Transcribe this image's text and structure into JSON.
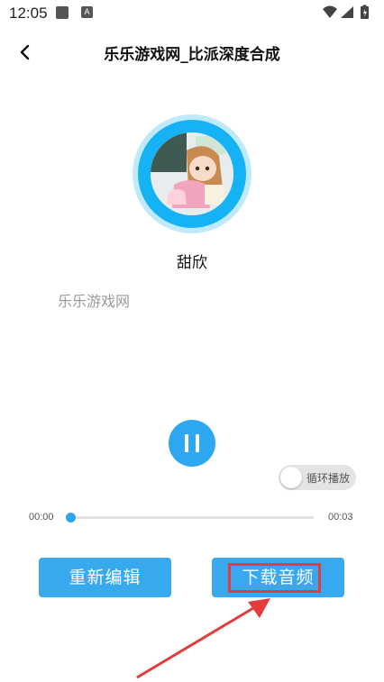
{
  "status_bar": {
    "time": "12:05",
    "a_glyph": "A"
  },
  "header": {
    "title": "乐乐游戏网_比派深度合成"
  },
  "track": {
    "name": "甜欣",
    "lyric": "乐乐游戏网"
  },
  "playback": {
    "current_time": "00:00",
    "total_time": "00:03",
    "progress_fraction": 0.0,
    "loop_label": "循环播放",
    "loop_enabled": false,
    "state": "playing"
  },
  "actions": {
    "edit_label": "重新编辑",
    "download_label": "下载音频"
  },
  "colors": {
    "accent": "#2ea7f2",
    "ring": "#15b3f5",
    "highlight": "#e23c3c"
  }
}
